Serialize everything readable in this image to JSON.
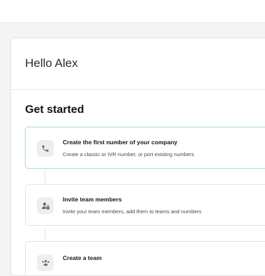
{
  "greeting": "Hello Alex",
  "section_title": "Get started",
  "steps": [
    {
      "icon": "phone-icon",
      "title": "Create the first number of your company",
      "description": "Create a classic or IVR number, or port existing numbers"
    },
    {
      "icon": "user-lock-icon",
      "title": "Invite team members",
      "description": "Invite your team members, add them to teams and numbers"
    },
    {
      "icon": "team-icon",
      "title": "Create a team",
      "description": ""
    }
  ],
  "colors": {
    "background": "#f4f4f2",
    "card": "#ffffff",
    "active_border": "#bfe3cf",
    "icon_bg": "#eeeeec"
  }
}
